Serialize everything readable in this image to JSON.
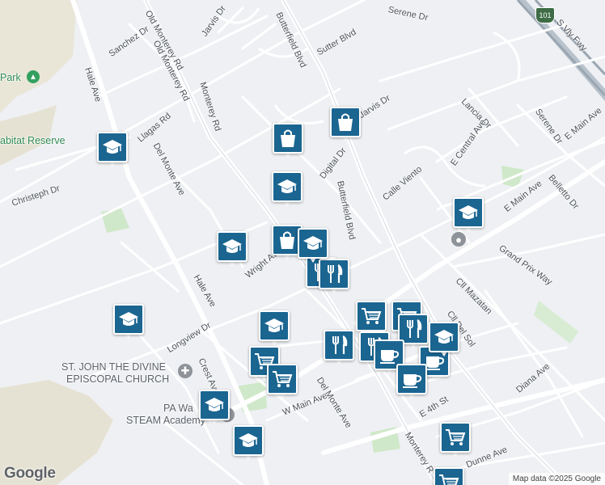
{
  "streets": [
    {
      "key": "jarvis-dr-1",
      "text": "Jarvis Dr"
    },
    {
      "key": "old-monterey-rd-top",
      "text": "Old Monterey Rd"
    },
    {
      "key": "serene-dr-top",
      "text": "Serene Dr"
    },
    {
      "key": "sanchez-dr",
      "text": "Sanchez Dr"
    },
    {
      "key": "old-monterey-rd",
      "text": "Old Monterey Rd"
    },
    {
      "key": "butterfield-blvd-top",
      "text": "Butterfield Blvd"
    },
    {
      "key": "sutter-blvd",
      "text": "Sutter Blvd"
    },
    {
      "key": "s-vly-fwy",
      "text": "S Vly Fwy"
    },
    {
      "key": "hale-ave-top",
      "text": "Hale Ave"
    },
    {
      "key": "monterey-rd",
      "text": "Monterey Rd"
    },
    {
      "key": "jarvis-dr-2",
      "text": "Jarvis Dr"
    },
    {
      "key": "lancia-dr",
      "text": "Lancia Dr"
    },
    {
      "key": "serene-dr",
      "text": "Serene Dr"
    },
    {
      "key": "e-main-ave-top",
      "text": "E Main Ave"
    },
    {
      "key": "llagas-rd",
      "text": "Llagas Rd"
    },
    {
      "key": "del-monte-ave-1",
      "text": "Del Monte Ave"
    },
    {
      "key": "digital-dr",
      "text": "Digital Dr"
    },
    {
      "key": "butterfield-blvd",
      "text": "Butterfield Blvd"
    },
    {
      "key": "e-central-ave",
      "text": "E Central Ave"
    },
    {
      "key": "belletto-dr",
      "text": "Belletto Dr"
    },
    {
      "key": "calle-viento",
      "text": "Calle Viento"
    },
    {
      "key": "christeph-dr",
      "text": "Christeph Dr"
    },
    {
      "key": "e-main-ave",
      "text": "E Main Ave"
    },
    {
      "key": "grand-prix-way",
      "text": "Grand Prix Way"
    },
    {
      "key": "wright-ave",
      "text": "Wright Ave"
    },
    {
      "key": "hale-ave",
      "text": "Hale Ave"
    },
    {
      "key": "cll-mazatan",
      "text": "Cll Mazatan"
    },
    {
      "key": "cll-del-sol",
      "text": "Cll Del Sol"
    },
    {
      "key": "longview-dr",
      "text": "Longview Dr"
    },
    {
      "key": "crest-ave",
      "text": "Crest Ave"
    },
    {
      "key": "diana-ave",
      "text": "Diana Ave"
    },
    {
      "key": "w-main-ave",
      "text": "W Main Ave"
    },
    {
      "key": "del-monte-ave-2",
      "text": "Del Monte Ave"
    },
    {
      "key": "e-4th-st",
      "text": "E 4th St"
    },
    {
      "key": "monterey-rd-bottom",
      "text": "Monterey R"
    },
    {
      "key": "dunne-ave",
      "text": "Dunne Ave"
    }
  ],
  "places": [
    {
      "key": "park",
      "text": "Park"
    },
    {
      "key": "habitat-reserve",
      "text": "abitat Reserve"
    },
    {
      "key": "church-1",
      "text": "ST. JOHN THE DIVINE"
    },
    {
      "key": "church-2",
      "text": "EPISCOPAL CHURCH"
    },
    {
      "key": "academy-1",
      "text": "PA Wa"
    },
    {
      "key": "academy-2",
      "text": "STEAM Academy"
    }
  ],
  "highway_shield": "101",
  "markers": [
    {
      "type": "school",
      "icon": "graduation-cap-icon"
    },
    {
      "type": "shopping",
      "icon": "shopping-bag-icon"
    },
    {
      "type": "shopping",
      "icon": "shopping-bag-icon"
    },
    {
      "type": "school",
      "icon": "graduation-cap-icon"
    },
    {
      "type": "school",
      "icon": "graduation-cap-icon"
    },
    {
      "type": "school",
      "icon": "graduation-cap-icon"
    },
    {
      "type": "school",
      "icon": "graduation-cap-icon"
    },
    {
      "type": "shopping",
      "icon": "shopping-bag-icon"
    },
    {
      "type": "restaurant",
      "icon": "fork-knife-icon"
    },
    {
      "type": "restaurant",
      "icon": "fork-knife-icon"
    },
    {
      "type": "school",
      "icon": "graduation-cap-icon"
    },
    {
      "type": "school",
      "icon": "graduation-cap-icon"
    },
    {
      "type": "grocery",
      "icon": "shopping-cart-icon"
    },
    {
      "type": "grocery",
      "icon": "shopping-cart-icon"
    },
    {
      "type": "restaurant",
      "icon": "fork-knife-icon"
    },
    {
      "type": "grocery",
      "icon": "shopping-cart-icon"
    },
    {
      "type": "grocery",
      "icon": "shopping-cart-icon"
    },
    {
      "type": "restaurant",
      "icon": "fork-knife-icon"
    },
    {
      "type": "restaurant",
      "icon": "fork-knife-icon"
    },
    {
      "type": "cafe",
      "icon": "coffee-cup-icon"
    },
    {
      "type": "cafe",
      "icon": "coffee-cup-icon"
    },
    {
      "type": "cafe",
      "icon": "coffee-cup-icon"
    },
    {
      "type": "school",
      "icon": "graduation-cap-icon"
    },
    {
      "type": "school",
      "icon": "graduation-cap-icon"
    },
    {
      "type": "school",
      "icon": "graduation-cap-icon"
    },
    {
      "type": "grocery",
      "icon": "shopping-cart-icon"
    },
    {
      "type": "grocery",
      "icon": "shopping-cart-icon"
    },
    {
      "type": "school",
      "icon": "graduation-cap-icon"
    }
  ],
  "attribution": "Map data ©2025 Google",
  "logo": "Google",
  "colors": {
    "marker": "#1b6591",
    "road": "#ffffff",
    "major_road": "#ffffff",
    "land": "#eef0f3",
    "park": "#cfe8c9",
    "hill": "#e6e2d3"
  }
}
